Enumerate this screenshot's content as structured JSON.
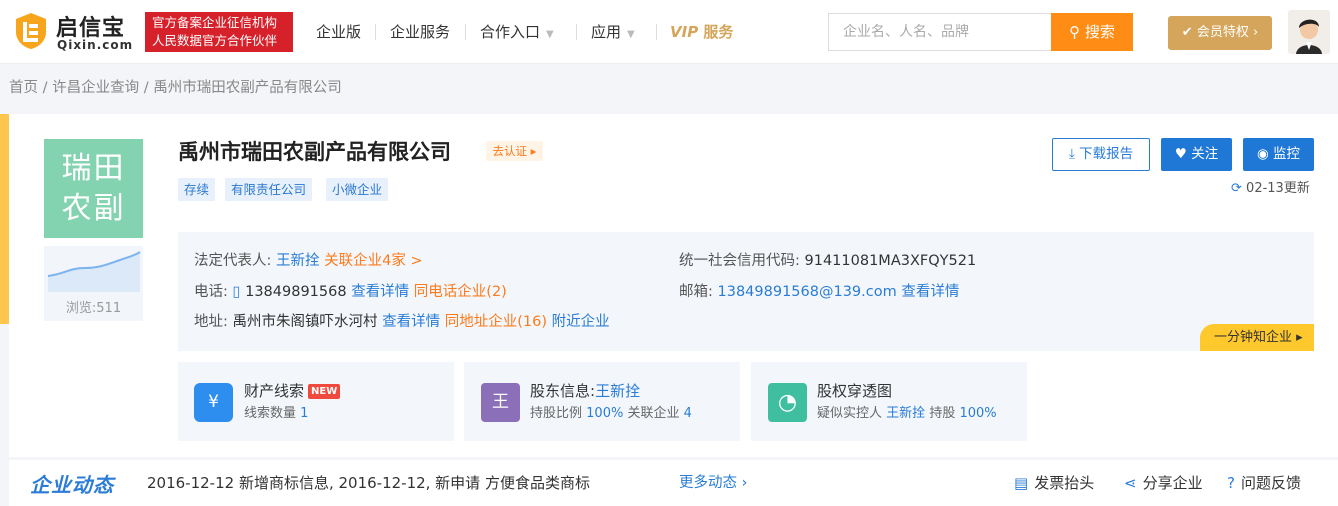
{
  "header": {
    "logo_name": "启信宝",
    "logo_domain": "Qixin.com",
    "badge_line1": "官方备案企业征信机构",
    "badge_line2": "人民数据官方合作伙伴",
    "nav": [
      "企业版",
      "企业服务",
      "合作入口",
      "应用"
    ],
    "vip_prefix": "VIP",
    "vip_suffix": "服务",
    "search_placeholder": "企业名、人名、品牌",
    "search_button": "搜索",
    "member_button": "会员特权"
  },
  "breadcrumb": [
    "首页",
    "许昌企业查询",
    "禹州市瑞田农副产品有限公司"
  ],
  "company": {
    "logo_text_line1": "瑞田",
    "logo_text_line2": "农副",
    "views": "浏览:511",
    "name": "禹州市瑞田农副产品有限公司",
    "verify": "去认证",
    "tags": [
      "存续",
      "有限责任公司",
      "小微企业"
    ],
    "actions": {
      "download": "下载报告",
      "follow": "关注",
      "monitor": "监控"
    },
    "updated": "02-13更新"
  },
  "info": {
    "legal_label": "法定代表人:",
    "legal_value": "王新拴",
    "related": "关联企业4家 >",
    "credit_label": "统一社会信用代码:",
    "credit_value": "91411081MA3XFQY521",
    "phone_label": "电话:",
    "phone_value": "13849891568",
    "phone_detail": "查看详情",
    "phone_same": "同电话企业(2)",
    "email_label": "邮箱:",
    "email_value": "13849891568@139.com",
    "email_detail": "查看详情",
    "addr_label": "地址:",
    "addr_value": "禹州市朱阁镇吓水河村",
    "addr_detail": "查看详情",
    "addr_same": "同地址企业(16)",
    "nearby": "附近企业",
    "one_min": "一分钟知企业"
  },
  "features": [
    {
      "icon": "¥",
      "title": "财产线索",
      "badge": "NEW",
      "sub_label": "线索数量",
      "sub_value": "1",
      "color": "#2e8ef0"
    },
    {
      "icon": "王",
      "title": "股东信息:",
      "title_value": "王新拴",
      "sub_label": "持股比例",
      "sub_value": "100%",
      "sub_label2": "关联企业",
      "sub_value2": "4",
      "color": "#8b6fb8"
    },
    {
      "icon": "◔",
      "title": "股权穿透图",
      "sub_label": "疑似实控人",
      "sub_value": "王新拴",
      "sub_label2": "持股",
      "sub_value2": "100%",
      "color": "#3fbf9f"
    }
  ],
  "dynamics": {
    "title": "企业动态",
    "text": "2016-12-12   新增商标信息,  2016-12-12, 新申请 方便食品类商标",
    "more": "更多动态"
  },
  "tools": [
    "发票抬头",
    "分享企业",
    "问题反馈"
  ]
}
